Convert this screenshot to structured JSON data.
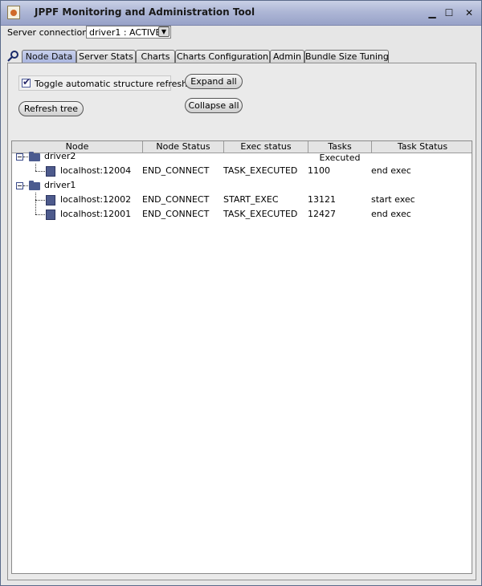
{
  "window": {
    "title": "JPPF Monitoring and Administration Tool",
    "controls": {
      "minimize": "▁",
      "maximize": "☐",
      "close": "✕"
    }
  },
  "server": {
    "label": "Server connection",
    "selected": "driver1 : ACTIVE"
  },
  "tabs": [
    {
      "label": "Node Data",
      "active": true
    },
    {
      "label": "Server Stats"
    },
    {
      "label": "Charts"
    },
    {
      "label": "Charts Configuration"
    },
    {
      "label": "Admin"
    },
    {
      "label": "Bundle Size Tuning"
    }
  ],
  "controls": {
    "toggle_refresh_label": "Toggle automatic structure refresh",
    "toggle_refresh_checked": true,
    "refresh_tree": "Refresh tree",
    "expand_all": "Expand all",
    "collapse_all": "Collapse all"
  },
  "table": {
    "columns": [
      "Node",
      "Node Status",
      "Exec status",
      "Tasks Executed",
      "Task Status"
    ],
    "drivers": [
      {
        "name": "driver2",
        "nodes": [
          {
            "node": "localhost:12004",
            "node_status": "END_CONNECT",
            "exec_status": "TASK_EXECUTED",
            "tasks_executed": "1100",
            "task_status": "end exec"
          }
        ]
      },
      {
        "name": "driver1",
        "nodes": [
          {
            "node": "localhost:12002",
            "node_status": "END_CONNECT",
            "exec_status": "START_EXEC",
            "tasks_executed": "13121",
            "task_status": "start exec"
          },
          {
            "node": "localhost:12001",
            "node_status": "END_CONNECT",
            "exec_status": "TASK_EXECUTED",
            "tasks_executed": "12427",
            "task_status": "end exec"
          }
        ]
      }
    ]
  },
  "colors": {
    "titlebar": "#aeb7d6",
    "active_tab": "#aab6df",
    "tree_icon": "#4b5b8f"
  }
}
